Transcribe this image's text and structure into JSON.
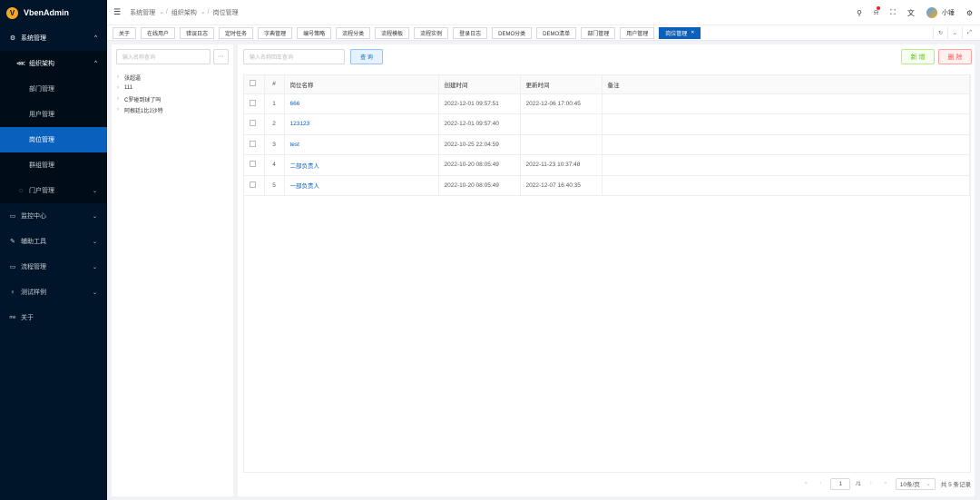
{
  "app": {
    "name": "VbenAdmin",
    "logo_glyph": "V"
  },
  "sidebar": {
    "items": [
      {
        "label": "系统管理",
        "icon": "gear-icon",
        "glyph": "⚙",
        "chevron": "^"
      },
      {
        "label": "组织架构",
        "icon": "org-icon",
        "glyph": "⋘",
        "chevron": "^"
      },
      {
        "label": "部门管理"
      },
      {
        "label": "用户管理"
      },
      {
        "label": "岗位管理"
      },
      {
        "label": "群组管理"
      },
      {
        "label": "门户管理",
        "icon": "shield-icon",
        "glyph": "◌",
        "chevron": "⌄"
      },
      {
        "label": "监控中心",
        "icon": "monitor-icon",
        "glyph": "▭",
        "chevron": "⌄"
      },
      {
        "label": "辅助工具",
        "icon": "tool-icon",
        "glyph": "✎",
        "chevron": "⌄"
      },
      {
        "label": "流程管理",
        "icon": "flow-icon",
        "glyph": "▭",
        "chevron": "⌄"
      },
      {
        "label": "测试样例",
        "icon": "trophy-icon",
        "glyph": "♀",
        "chevron": "⌄"
      },
      {
        "label": "关于",
        "icon": "about-icon",
        "glyph": "me"
      }
    ]
  },
  "header": {
    "breadcrumb": [
      "系统管理",
      "组织架构",
      "岗位管理"
    ],
    "user_name": "小锤"
  },
  "tabs": [
    {
      "label": "关于"
    },
    {
      "label": "在线用户"
    },
    {
      "label": "错误日志"
    },
    {
      "label": "定时任务"
    },
    {
      "label": "字典管理"
    },
    {
      "label": "编号策略"
    },
    {
      "label": "流程分类"
    },
    {
      "label": "流程模板"
    },
    {
      "label": "流程实例"
    },
    {
      "label": "登录日志"
    },
    {
      "label": "DEMO分类"
    },
    {
      "label": "DEMO清单"
    },
    {
      "label": "部门管理"
    },
    {
      "label": "用户管理"
    },
    {
      "label": "岗位管理",
      "active": true
    }
  ],
  "tree": {
    "placeholder": "输入名称查询",
    "more": "···",
    "nodes": [
      "张超逼",
      "111",
      "C罗碰到球了吗",
      "阿根廷1比2沙特"
    ]
  },
  "main": {
    "search_placeholder": "输入名称回车查询",
    "query_label": "查 询",
    "new_label": "新 增",
    "delete_label": "删 除",
    "columns": {
      "index": "#",
      "name": "岗位名称",
      "created": "创建时间",
      "updated": "更新时间",
      "remark": "备注"
    },
    "rows": [
      {
        "index": "1",
        "name": "666",
        "created": "2022-12-01 09:57:51",
        "updated": "2022-12-06 17:00:45",
        "remark": ""
      },
      {
        "index": "2",
        "name": "123123",
        "created": "2022-12-01 09:57:40",
        "updated": "",
        "remark": ""
      },
      {
        "index": "3",
        "name": "test",
        "created": "2022-10-25 22:04:59",
        "updated": "",
        "remark": ""
      },
      {
        "index": "4",
        "name": "二部负责人",
        "created": "2022-10-20 08:05:49",
        "updated": "2022-11-23 10:37:48",
        "remark": ""
      },
      {
        "index": "5",
        "name": "一部负责人",
        "created": "2022-10-20 08:05:49",
        "updated": "2022-12-07 16:40:35",
        "remark": ""
      }
    ]
  },
  "pagination": {
    "page": "1",
    "total_pages": "/1",
    "page_size": "10条/页",
    "total": "共 5 条记录"
  }
}
